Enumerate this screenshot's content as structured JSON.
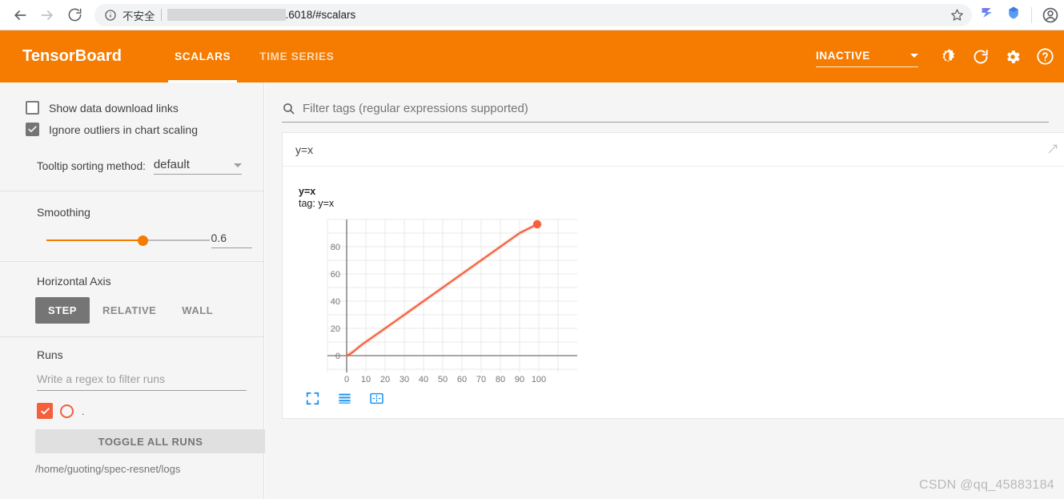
{
  "browser": {
    "back_icon": "arrow-left-icon",
    "forward_icon": "arrow-right-icon",
    "reload_icon": "reload-icon",
    "info_icon": "info-circle-icon",
    "security_label": "不安全",
    "url": ".6018/#scalars",
    "star_icon": "bookmark-star-icon",
    "extension1_icon": "extension-bird-icon",
    "extension2_icon": "extension-shield-icon",
    "profile_icon": "profile-avatar-icon"
  },
  "header": {
    "logo": "TensorBoard",
    "brand_color": "#f57c00",
    "tabs": [
      {
        "label": "SCALARS",
        "active": true
      },
      {
        "label": "TIME SERIES",
        "active": false
      }
    ],
    "reload_status": "INACTIVE",
    "dropdown_icon": "chevron-down-icon",
    "brightness_icon": "brightness-icon",
    "refresh_icon": "refresh-icon",
    "settings_icon": "gear-icon",
    "help_icon": "help-circle-icon"
  },
  "sidebar": {
    "checkboxes": [
      {
        "label": "Show data download links",
        "checked": false
      },
      {
        "label": "Ignore outliers in chart scaling",
        "checked": true
      }
    ],
    "tooltip": {
      "label": "Tooltip sorting method:",
      "value": "default",
      "caret_icon": "caret-down-icon"
    },
    "smoothing": {
      "title": "Smoothing",
      "value": "0.6"
    },
    "horizontal_axis": {
      "title": "Horizontal Axis",
      "options": [
        {
          "label": "STEP",
          "active": true
        },
        {
          "label": "RELATIVE",
          "active": false
        },
        {
          "label": "WALL",
          "active": false
        }
      ]
    },
    "runs": {
      "title": "Runs",
      "filter_placeholder": "Write a regex to filter runs",
      "run_checkbox_icon": "checkmark-icon",
      "run_color_icon": "run-color-circle-icon",
      "run_name": ".",
      "toggle_all_label": "TOGGLE ALL RUNS",
      "logdir": "/home/guoting/spec-resnet/logs",
      "accent_color": "#f4603e"
    }
  },
  "main": {
    "filter": {
      "search_icon": "search-icon",
      "placeholder": "Filter tags (regular expressions supported)"
    },
    "card": {
      "title": "y=x",
      "expand_icon": "expand-diagonal-icon",
      "chart_label": "y=x",
      "chart_sublabel": "tag: y=x",
      "tools": [
        {
          "icon": "fullscreen-icon",
          "name": "expand-chart-button"
        },
        {
          "icon": "data-table-icon",
          "name": "toggle-data-table-button"
        },
        {
          "icon": "fit-domain-icon",
          "name": "reset-zoom-button"
        }
      ]
    }
  },
  "chart_data": {
    "type": "line",
    "title": "y=x",
    "subtitle": "tag: y=x",
    "xlabel": "",
    "ylabel": "",
    "xlim": [
      -10,
      110
    ],
    "ylim": [
      -10,
      100
    ],
    "xticks": [
      0,
      10,
      20,
      30,
      40,
      50,
      60,
      70,
      80,
      90,
      100
    ],
    "yticks": [
      0,
      20,
      40,
      60,
      80
    ],
    "grid": true,
    "legend": "none",
    "line_color": "#f4603e",
    "series": [
      {
        "name": "y=x",
        "smoothed": true,
        "x": [
          0,
          10,
          20,
          30,
          40,
          50,
          60,
          70,
          80,
          90,
          99
        ],
        "y": [
          0,
          8,
          18,
          28,
          39,
          49,
          59,
          69,
          79,
          89,
          96
        ]
      }
    ],
    "last_point": {
      "x": 99,
      "y": 96
    }
  },
  "watermark": "CSDN @qq_45883184"
}
